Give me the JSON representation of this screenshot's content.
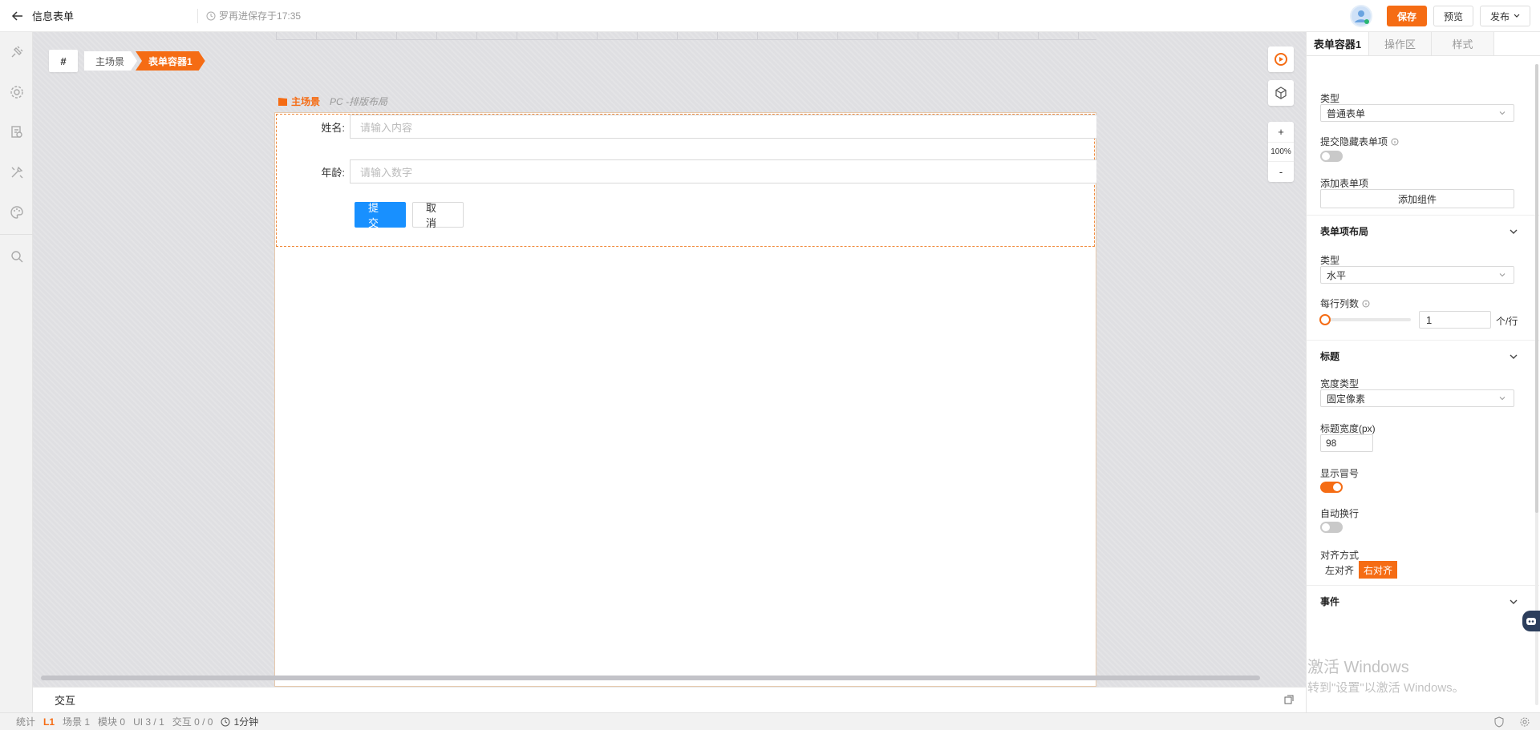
{
  "header": {
    "title": "信息表单",
    "save_hint": "罗再进保存于17:35",
    "save_label": "保存",
    "preview_label": "预览",
    "publish_label": "发布"
  },
  "breadcrumb": {
    "hash": "#",
    "items": [
      "主场景",
      "表单容器1"
    ]
  },
  "scene": {
    "name": "主场景",
    "subtitle": "PC -排版布局"
  },
  "form": {
    "fields": [
      {
        "label": "姓名:",
        "placeholder": "请输入内容"
      },
      {
        "label": "年龄:",
        "placeholder": "请输入数字"
      }
    ],
    "submit_label": "提 交",
    "cancel_label": "取 消"
  },
  "zoom": {
    "plus": "+",
    "value": "100%",
    "minus": "-"
  },
  "interaction": {
    "title": "交互"
  },
  "statusbar": {
    "stats_label": "统计",
    "level": "L1",
    "scenes": "场景 1",
    "modules": "模块 0",
    "ui": "UI 3 / 1",
    "interaction": "交互 0 / 0",
    "time": "1分钟"
  },
  "panel": {
    "tabs": [
      "表单容器1",
      "操作区",
      "样式"
    ],
    "type_label": "类型",
    "type_value": "普通表单",
    "hidden_submit_label": "提交隐藏表单项",
    "hidden_submit_on": false,
    "add_item_label": "添加表单项",
    "add_component_label": "添加组件",
    "layout_section": "表单项布局",
    "layout_type_label": "类型",
    "layout_type_value": "水平",
    "columns_label": "每行列数",
    "columns_value": "1",
    "columns_unit": "个/行",
    "title_section": "标题",
    "width_type_label": "宽度类型",
    "width_type_value": "固定像素",
    "title_width_label": "标题宽度(px)",
    "title_width_value": "98",
    "show_colon_label": "显示冒号",
    "show_colon_on": true,
    "auto_wrap_label": "自动换行",
    "auto_wrap_on": false,
    "align_label": "对齐方式",
    "align_options": [
      "左对齐",
      "右对齐"
    ],
    "align_selected": "右对齐",
    "events_section": "事件"
  },
  "watermark": {
    "line1": "激活 Windows",
    "line2": "转到\"设置\"以激活 Windows。"
  },
  "colors": {
    "accent": "#f56c14",
    "primary_blue": "#1890ff"
  }
}
